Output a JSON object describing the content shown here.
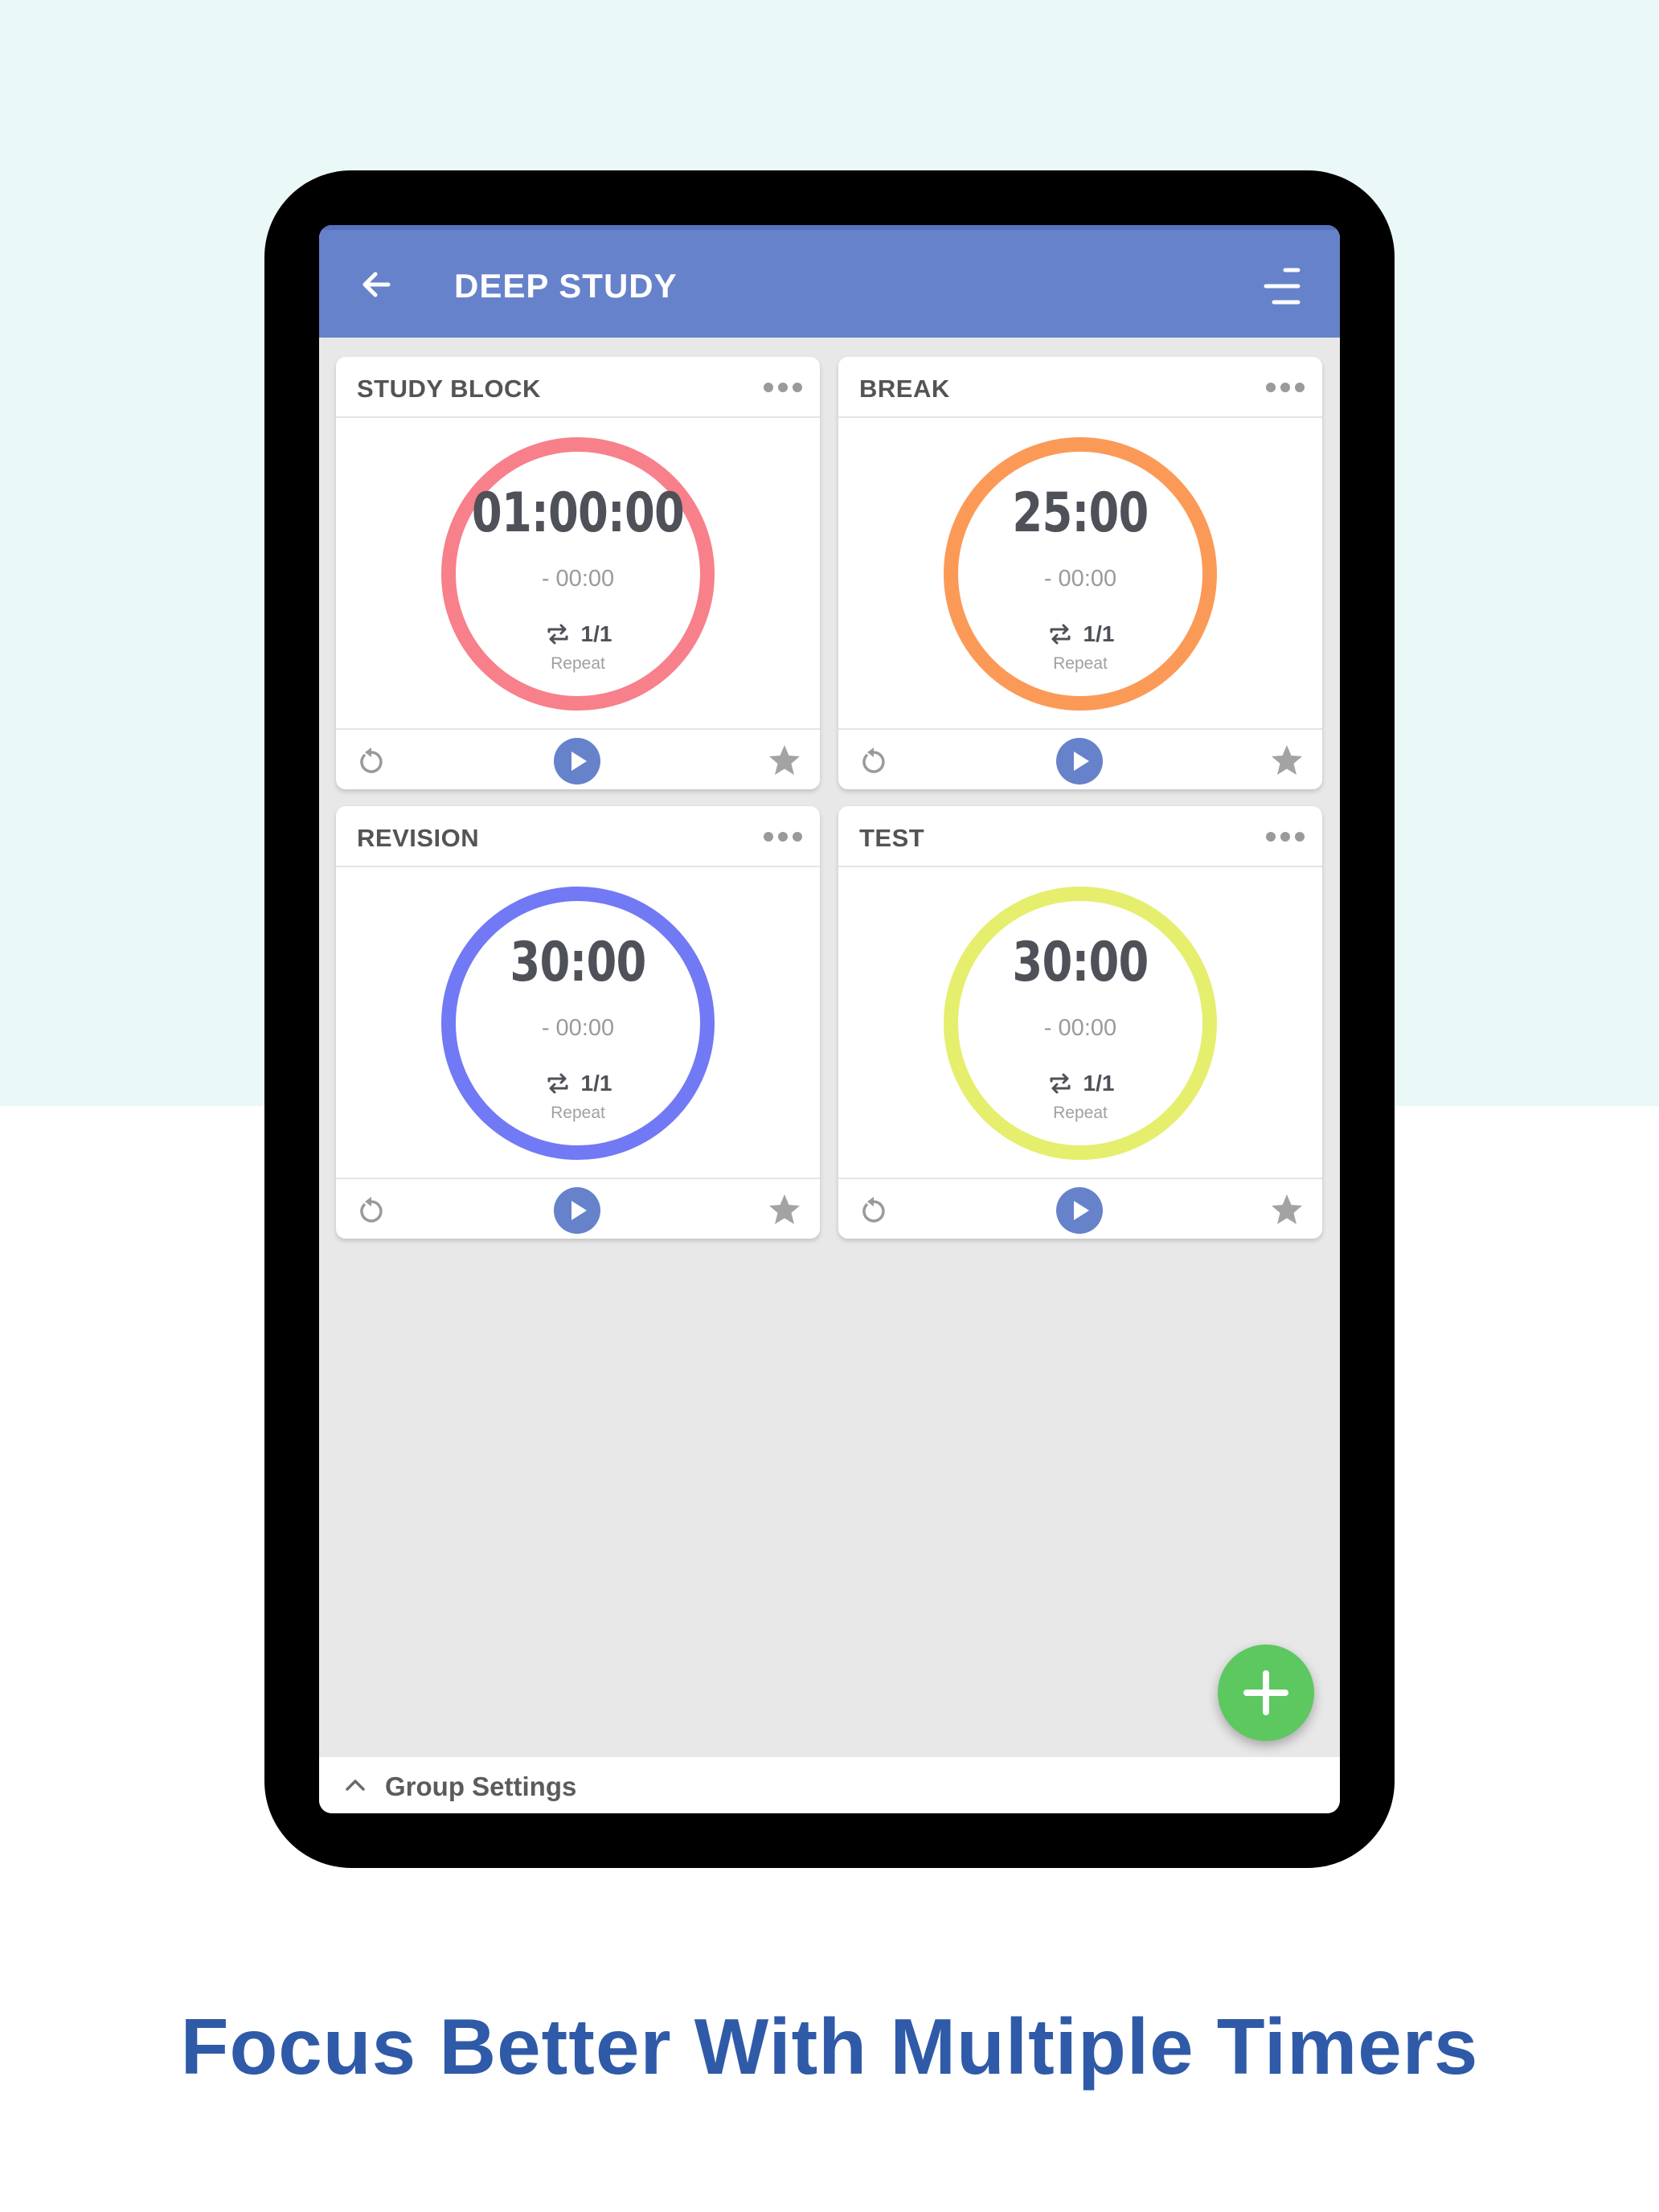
{
  "header": {
    "title": "DEEP STUDY",
    "back_icon": "arrow-left-icon",
    "menu_icon": "sort-menu-icon"
  },
  "timers": [
    {
      "name": "STUDY BLOCK",
      "time": "01:00:00",
      "elapsed": "- 00:00",
      "repeat": "1/1",
      "repeat_label": "Repeat",
      "ring_color": "#f7808a"
    },
    {
      "name": "BREAK",
      "time": "25:00",
      "elapsed": "- 00:00",
      "repeat": "1/1",
      "repeat_label": "Repeat",
      "ring_color": "#fb9a57"
    },
    {
      "name": "REVISION",
      "time": "30:00",
      "elapsed": "- 00:00",
      "repeat": "1/1",
      "repeat_label": "Repeat",
      "ring_color": "#7279f4"
    },
    {
      "name": "TEST",
      "time": "30:00",
      "elapsed": "- 00:00",
      "repeat": "1/1",
      "repeat_label": "Repeat",
      "ring_color": "#e6ee6d"
    }
  ],
  "footer": {
    "group_settings": "Group Settings"
  },
  "caption": "Focus Better With Multiple Timers",
  "colors": {
    "accent": "#6682ca",
    "fab": "#5dc860",
    "caption": "#2f5aa8"
  }
}
